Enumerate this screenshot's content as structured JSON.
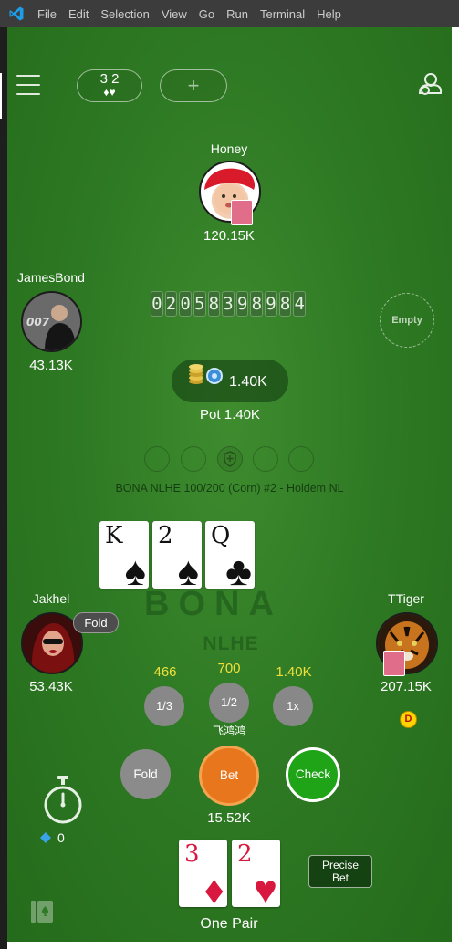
{
  "menubar": {
    "app_icon": "vscode-icon",
    "items": [
      "File",
      "Edit",
      "Selection",
      "View",
      "Go",
      "Run",
      "Terminal",
      "Help"
    ]
  },
  "toolbar": {
    "menu_icon": "hamburger-icon",
    "hand_ranks": "3 2",
    "hand_suits": "♦♥",
    "add_label": "+",
    "settings_icon": "profile-settings-icon"
  },
  "players": {
    "top": {
      "name": "Honey",
      "chips": "120.15K"
    },
    "left": {
      "name": "JamesBond",
      "chips": "43.13K"
    },
    "bottom_left": {
      "name": "Jakhel",
      "chips": "53.43K",
      "status": "Fold"
    },
    "right": {
      "name": "TTiger",
      "chips": "207.15K",
      "dealer": "D"
    },
    "right_empty": {
      "label": "Empty"
    },
    "hero": {
      "name": "飞鸿鸿",
      "chips": "15.52K",
      "diamonds": "0"
    }
  },
  "game_counter": [
    "0",
    "2",
    "0",
    "5",
    "8",
    "3",
    "9",
    "8",
    "9",
    "8",
    "4"
  ],
  "pot": {
    "amount": "1.40K",
    "label": "Pot 1.40K"
  },
  "table_info": "BONA NLHE 100/200 (Corn) #2 - Holdem NL",
  "board": [
    {
      "rank": "K",
      "suit": "♠",
      "color": "#111111"
    },
    {
      "rank": "2",
      "suit": "♠",
      "color": "#111111"
    },
    {
      "rank": "Q",
      "suit": "♣",
      "color": "#111111"
    }
  ],
  "logo": {
    "text": "BONA",
    "sub": "NLHE"
  },
  "bet_presets": [
    {
      "value": "466",
      "label": "1/3"
    },
    {
      "value": "700",
      "label": "1/2"
    },
    {
      "value": "1.40K",
      "label": "1x"
    }
  ],
  "actions": {
    "fold": "Fold",
    "bet": "Bet",
    "check": "Check"
  },
  "hole_cards": [
    {
      "rank": "3",
      "suit": "♦",
      "color": "#d9183f"
    },
    {
      "rank": "2",
      "suit": "♥",
      "color": "#d9183f"
    }
  ],
  "hand_result": "One Pair",
  "precise_bet": {
    "line1": "Precise",
    "line2": "Bet"
  },
  "colors": {
    "felt": "#2f7a24",
    "bet": "#e8761c",
    "check": "#1fa418",
    "preset_value": "#f0e13a"
  }
}
